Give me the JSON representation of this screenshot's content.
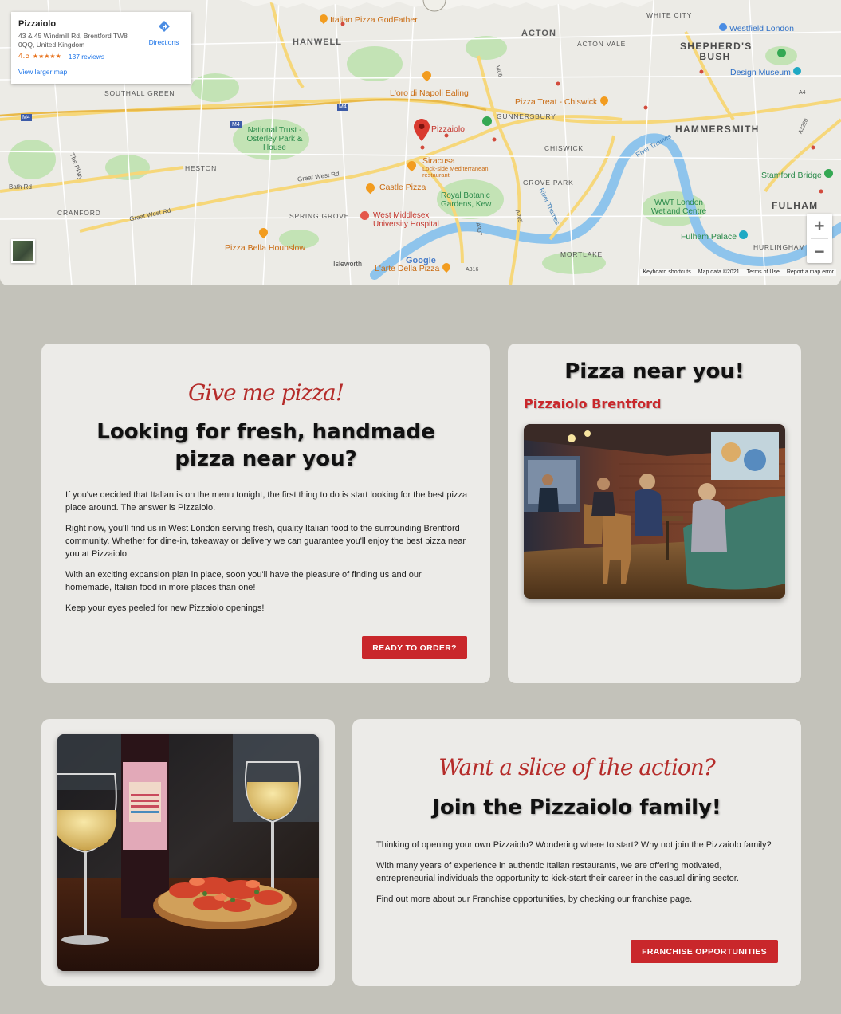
{
  "map": {
    "card": {
      "place_name": "Pizzaiolo",
      "address": "43 & 45 Windmill Rd, Brentford TW8 0QQ, United Kingdom",
      "rating": "4.5",
      "stars": "★★★★★",
      "reviews": "137 reviews",
      "directions_label": "Directions",
      "larger_map": "View larger map"
    },
    "areas": {
      "hanwell": "HANWELL",
      "acton": "ACTON",
      "acton_vale": "ACTON VALE",
      "white_city": "WHITE CITY",
      "shepherds_bush": "SHEPHERD'S BUSH",
      "southall_green": "SOUTHALL GREEN",
      "gunnersbury": "GUNNERSBURY",
      "hammersmith": "HAMMERSMITH",
      "chiswick": "CHISWICK",
      "heston": "HESTON",
      "grove_park": "GROVE PARK",
      "cranford": "CRANFORD",
      "spring_grove": "SPRING GROVE",
      "fulham": "FULHAM",
      "mortlake": "MORTLAKE",
      "hurlingham": "HURLINGHAM",
      "isleworth": "Isleworth"
    },
    "pois": {
      "godfather": "Italian Pizza GodFather",
      "westfield": "Westfield London",
      "design_museum": "Design Museum",
      "oro_napoli": "L'oro di Napoli Ealing",
      "pizza_treat": "Pizza Treat - Chiswick",
      "pizzaiolo": "Pizzaiolo",
      "national_trust": "National Trust - Osterley Park & House",
      "siracusa": "Siracusa",
      "siracusa_sub": "Lock-side Mediterranean restaurant",
      "castle_pizza": "Castle Pizza",
      "kew": "Royal Botanic Gardens, Kew",
      "west_middlesex": "West Middlesex University Hospital",
      "wwt": "WWT London Wetland Centre",
      "stamford_bridge": "Stamford Bridge",
      "fulham_palace": "Fulham Palace",
      "pizza_bella": "Pizza Bella Hounslow",
      "arte_pizza": "L'arte Della Pizza"
    },
    "roads": {
      "bath_rd": "Bath Rd",
      "great_west_rd": "Great West Rd",
      "the_pkwy": "The Pkwy",
      "river_thames": "River Thames",
      "m4": "M4",
      "a406": "A406",
      "a4": "A4",
      "a205": "A205",
      "a307": "A307",
      "a316": "A316",
      "a3220": "A3220"
    },
    "google": "Google",
    "footer": {
      "shortcuts": "Keyboard shortcuts",
      "data": "Map data ©2021",
      "terms": "Terms of Use",
      "report": "Report a map error"
    },
    "zoom_in": "+",
    "zoom_out": "−",
    "colors": {
      "pin": "#d93a2f",
      "water": "#8ec4ec",
      "park": "#c3e3b5",
      "road": "#f6d77a"
    }
  },
  "card1": {
    "script": "Give me pizza!",
    "heading": "Looking for fresh, handmade pizza near you?",
    "paragraphs": [
      "If you've decided that Italian is on the menu tonight, the first thing to do is start looking for the best pizza place around. The answer is Pizzaiolo.",
      "Right now, you'll find us in West London serving fresh, quality Italian food to the surrounding Brentford community. Whether for dine-in, takeaway or delivery we can guarantee you'll enjoy the best pizza near you at Pizzaiolo.",
      "With an exciting expansion plan in place, soon you'll have the pleasure of finding us and our homemade, Italian food in more places than one!",
      "Keep your eyes peeled for new Pizzaiolo openings!"
    ],
    "button": "READY TO ORDER?"
  },
  "card2": {
    "heading": "Pizza near you!",
    "location": "Pizzaiolo Brentford"
  },
  "card4": {
    "script": "Want a slice of the action?",
    "heading": "Join the Pizzaiolo family!",
    "paragraphs": [
      "Thinking of opening your own Pizzaiolo? Wondering where to start? Why not join the Pizzaiolo family?",
      "With many years of experience in authentic Italian restaurants, we are offering motivated, entrepreneurial individuals the opportunity to kick-start their career in the casual dining sector.",
      "Find out more about our Franchise opportunities, by checking our franchise page."
    ],
    "button": "FRANCHISE OPPORTUNITIES"
  },
  "colors": {
    "background": "#c3c2ba",
    "card": "#ecebe8",
    "accent_red": "#c9272b",
    "script_red": "#b52c2a"
  }
}
